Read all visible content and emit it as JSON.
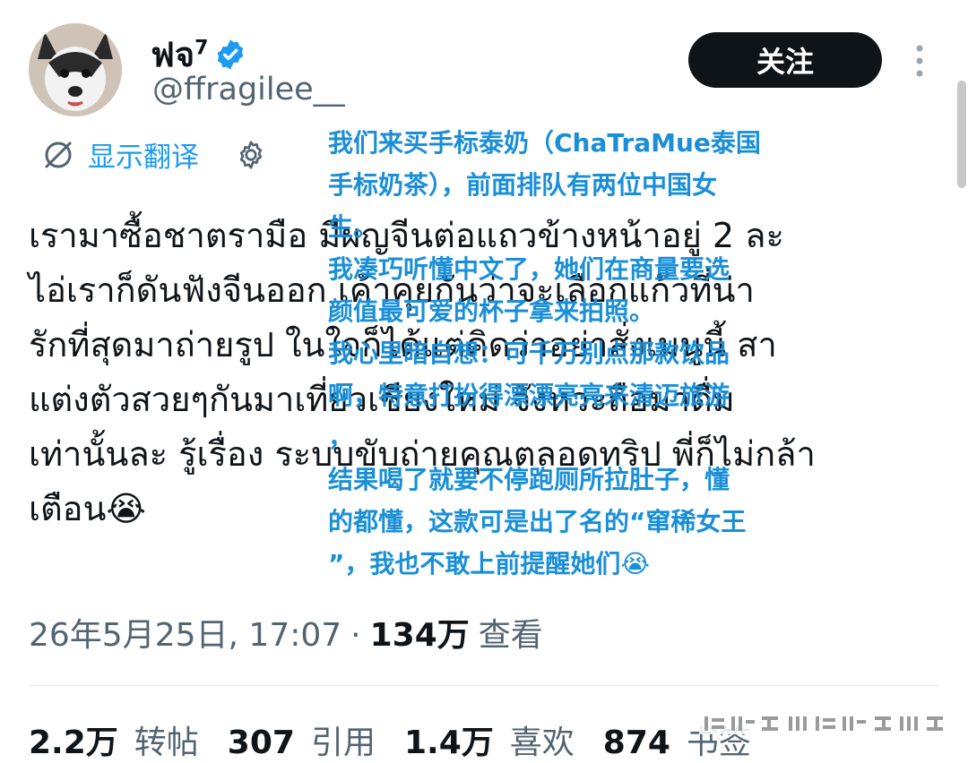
{
  "author": {
    "display_name": "ฟจ",
    "name_superscript": "7",
    "handle": "@ffragilee__",
    "avatar_icon": "husky-avatar",
    "verified_icon": "verified-badge-icon"
  },
  "follow_label": "关注",
  "translate": {
    "label": "显示翻译"
  },
  "post_text": "เรามาซื้อชาตรามือ มีผญจีนต่อแถวข้างหน้าอยู่ 2 ละ\nไอ่เราก็ดันฟังจีนออก เค้าคุยกันว่าจะเลือกแก้วที่น่า\nรักที่สุดมาถ่ายรูป ในใจก็ได้แต่คิดว่าอย่าสั่งเมนูนี้ สา\nแต่งตัวสวยๆกันมาเที่ยวเชียงใหม่ จังหวะถือมาดื่ม\nเท่านั้นละ รู้เรื่อง ระบบขับถ่ายคุณตลอดทริป พี่ก็ไม่กล้า\nเตือน😭",
  "translation_overlay": "我们来买手标泰奶（ChaTraMue泰国\n手标奶茶），前面排队有两位中国女\n生。\n我凑巧听懂中文了，她们在商量要选\n颜值最可爱的杯子拿来拍照。\n我心里暗自想：可千万别点那款饮品\n啊，特意打扮得漂漂亮亮来清迈旅游\n，\n结果喝了就要不停跑厕所拉肚子，懂\n的都懂，这款可是出了名的“窜稀女王\n”，我也不敢上前提醒她们😭",
  "meta": {
    "timestamp": "26年5月25日, 17:07",
    "separator": "·",
    "views_count": "134万",
    "views_label": "查看"
  },
  "stats": [
    {
      "count": "2.2万",
      "label": "转帖"
    },
    {
      "count": "307",
      "label": "引用"
    },
    {
      "count": "1.4万",
      "label": "喜欢"
    },
    {
      "count": "874",
      "label": "书签"
    }
  ],
  "colors": {
    "accent": "#1d9bf0",
    "overlay_text": "#1a8fd8",
    "button_bg": "#0f1419",
    "secondary_text": "#536471"
  }
}
